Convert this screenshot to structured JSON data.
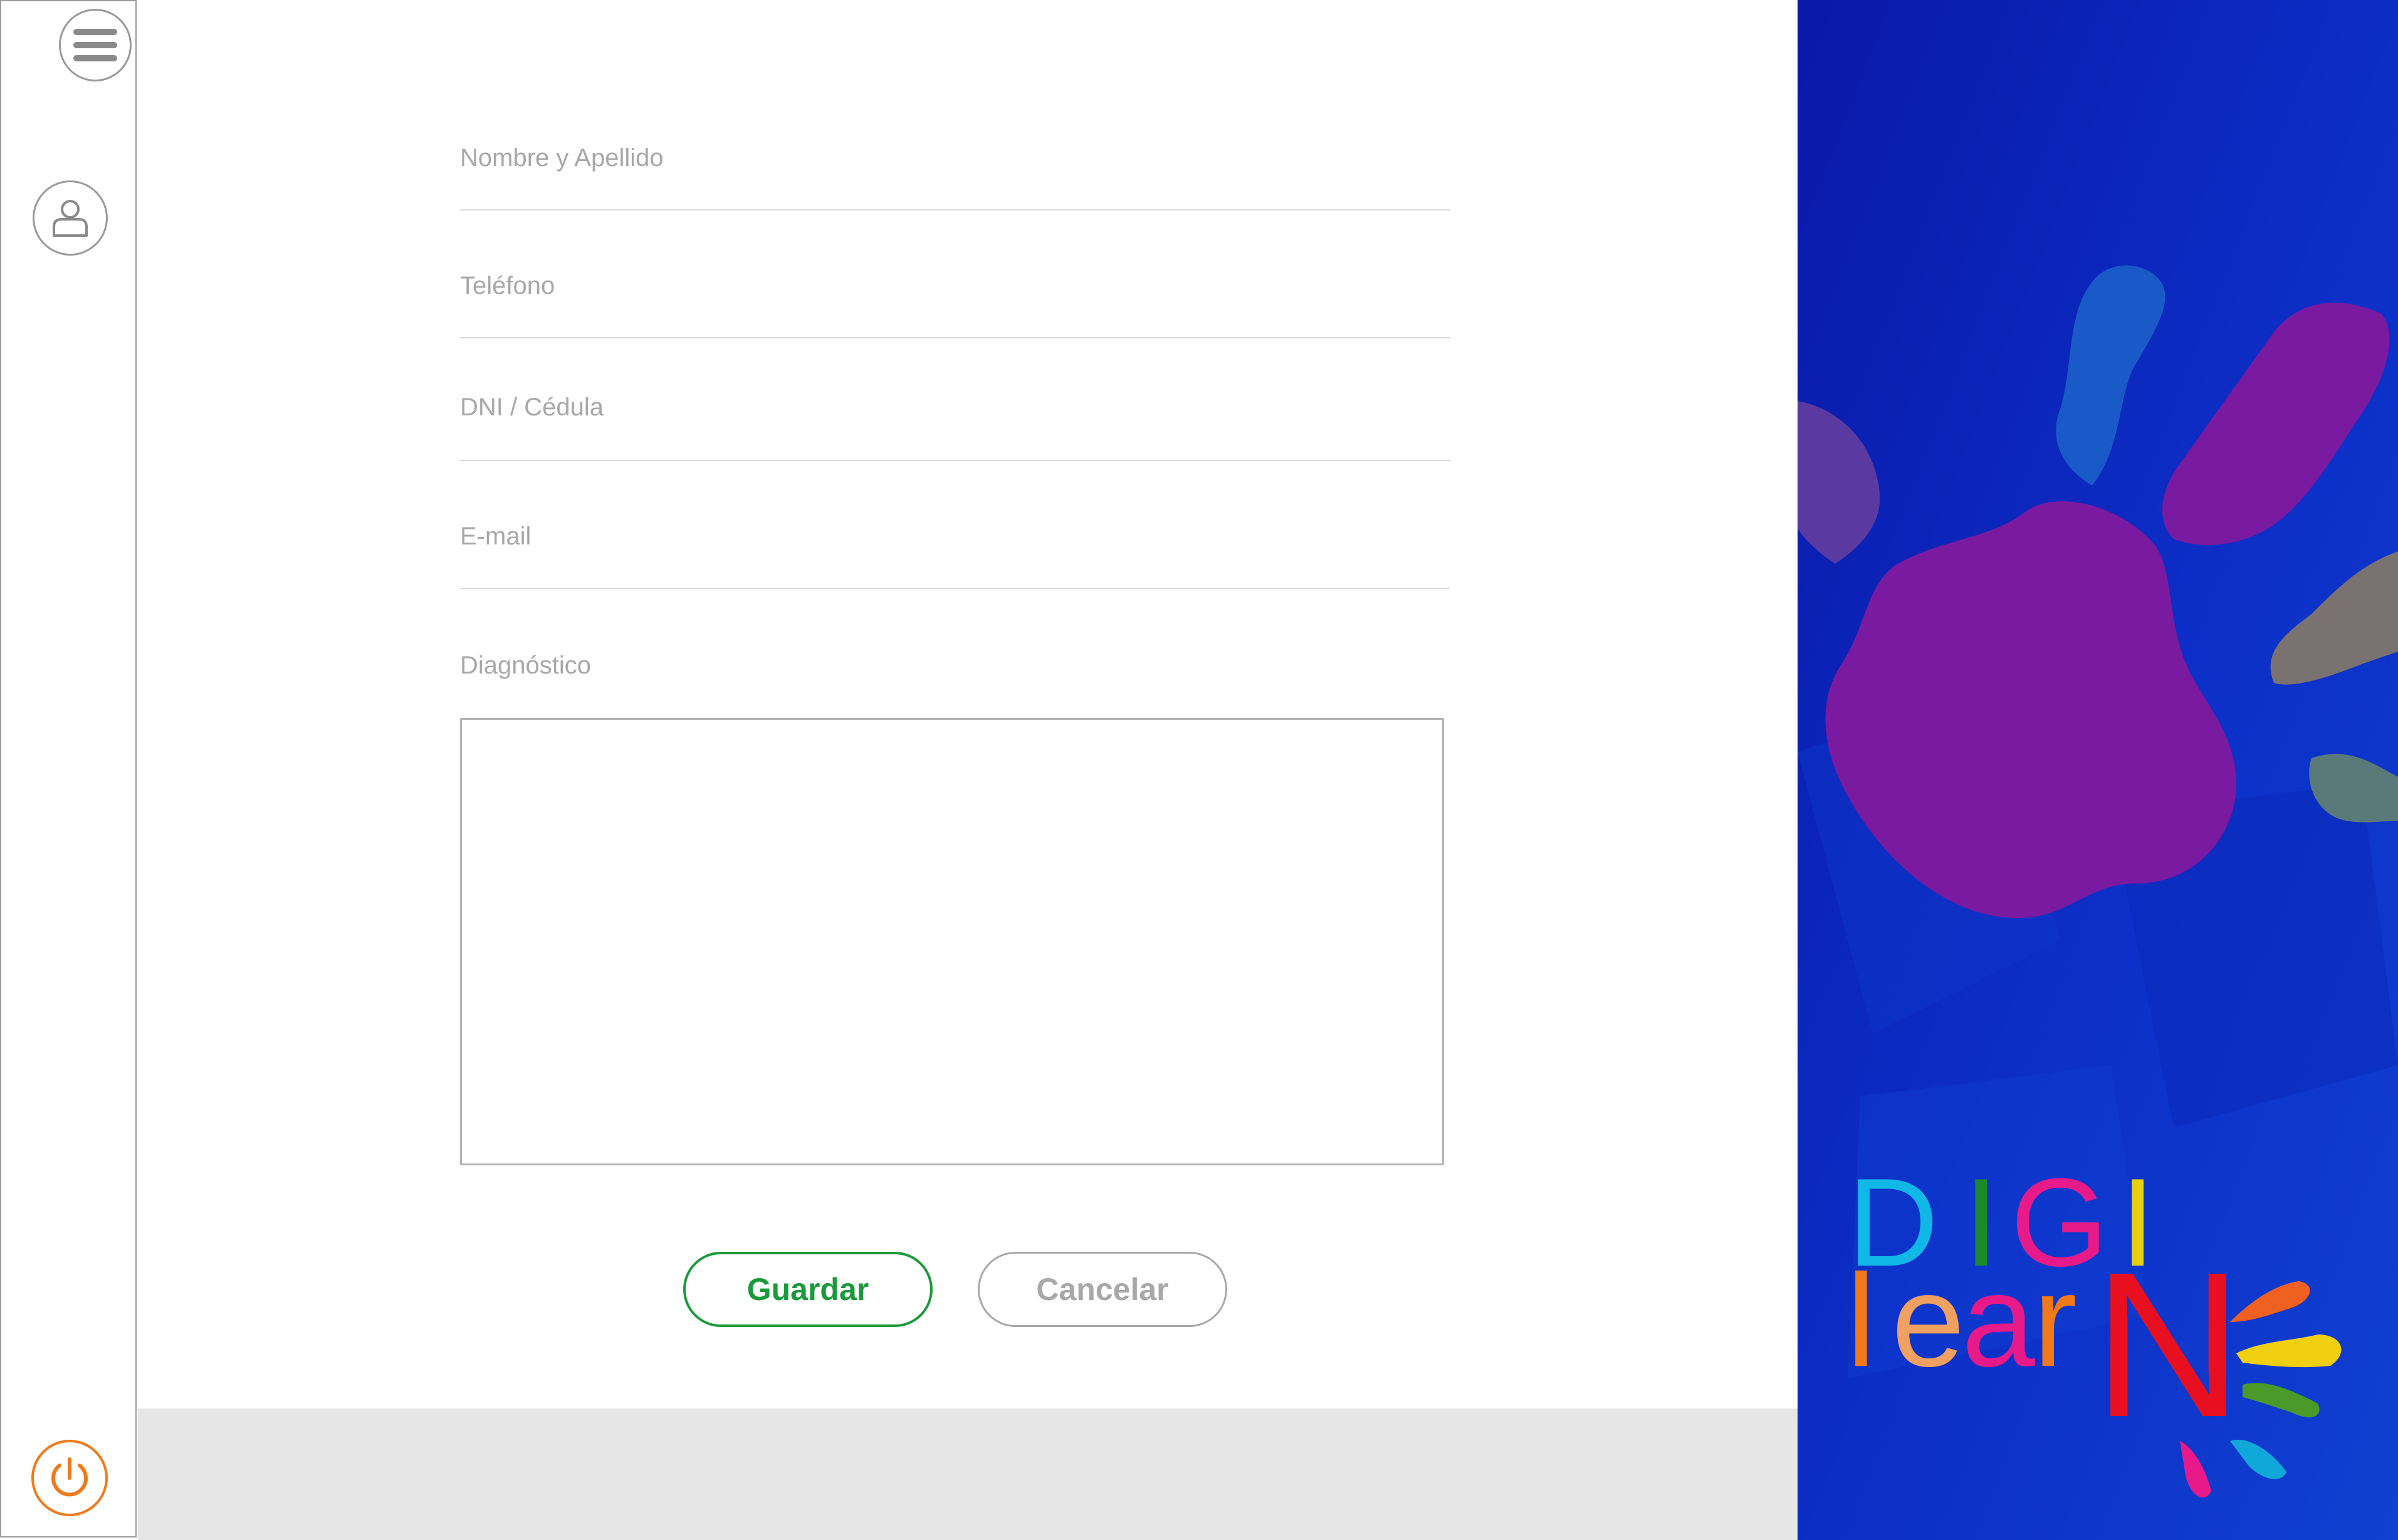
{
  "form": {
    "fields": [
      {
        "label": "Nombre y Apellido",
        "value": ""
      },
      {
        "label": "Teléfono",
        "value": ""
      },
      {
        "label": "DNI / Cédula",
        "value": ""
      },
      {
        "label": "E-mail",
        "value": ""
      }
    ],
    "diagnosis_label": "Diagnóstico",
    "diagnosis_value": ""
  },
  "buttons": {
    "save": "Guardar",
    "cancel": "Cancelar"
  },
  "brand": {
    "logo_line1": [
      "D",
      "I",
      "G",
      "I"
    ],
    "logo_line2": [
      "l",
      "e",
      "a",
      "r",
      "N"
    ]
  },
  "colors": {
    "accent_green": "#1a9a3a",
    "power_orange": "#f07a1a",
    "panel_blue": "#1020b0"
  },
  "icons": {
    "menu": "hamburger-menu-icon",
    "user": "user-icon",
    "power": "power-icon"
  }
}
